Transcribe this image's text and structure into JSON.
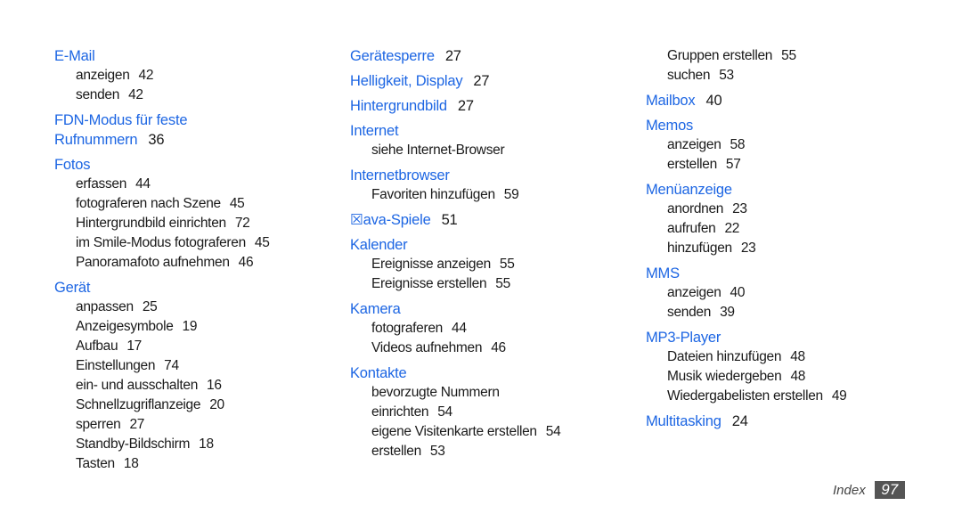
{
  "columns": [
    {
      "entries": [
        {
          "heading": "E-Mail",
          "page": "",
          "subs": [
            {
              "text": "anzeigen",
              "page": "42"
            },
            {
              "text": "senden",
              "page": "42"
            }
          ]
        },
        {
          "heading": "FDN-Modus für feste",
          "heading_cont": "Rufnummern",
          "page": "36",
          "subs": []
        },
        {
          "heading": "Fotos",
          "page": "",
          "subs": [
            {
              "text": "erfassen",
              "page": "44"
            },
            {
              "text": "fotograferen nach Szene",
              "page": "45"
            },
            {
              "text": "Hintergrundbild einrichten",
              "page": "72"
            },
            {
              "text": "im Smile-Modus fotograferen",
              "page": "45"
            },
            {
              "text": "Panoramafoto aufnehmen",
              "page": "46"
            }
          ]
        },
        {
          "heading": "Gerät",
          "page": "",
          "subs": [
            {
              "text": "anpassen",
              "page": "25"
            },
            {
              "text": "Anzeigesymbole",
              "page": "19"
            },
            {
              "text": "Aufbau",
              "page": "17"
            },
            {
              "text": "Einstellungen",
              "page": "74"
            },
            {
              "text": "ein- und ausschalten",
              "page": "16"
            },
            {
              "text": "Schnellzugriflanzeige",
              "page": "20"
            },
            {
              "text": "sperren",
              "page": "27"
            },
            {
              "text": "Standby-Bildschirm",
              "page": "18"
            },
            {
              "text": "Tasten",
              "page": "18"
            }
          ]
        }
      ]
    },
    {
      "entries": [
        {
          "heading": "Gerätesperre",
          "page": "27",
          "subs": []
        },
        {
          "heading": "Helligkeit, Display",
          "page": "27",
          "subs": []
        },
        {
          "heading": "Hintergrundbild",
          "page": "27",
          "subs": []
        },
        {
          "heading": "Internet",
          "page": "",
          "subs": [
            {
              "text": "siehe Internet-Browser",
              "page": ""
            }
          ]
        },
        {
          "heading": "Internetbrowser",
          "page": "",
          "subs": [
            {
              "text": "Favoriten hinzufügen",
              "page": "59"
            }
          ]
        },
        {
          "heading": "☒ava-Spiele",
          "page": "51",
          "subs": []
        },
        {
          "heading": "Kalender",
          "page": "",
          "subs": [
            {
              "text": "Ereignisse anzeigen",
              "page": "55"
            },
            {
              "text": "Ereignisse erstellen",
              "page": "55"
            }
          ]
        },
        {
          "heading": "Kamera",
          "page": "",
          "subs": [
            {
              "text": "fotograferen",
              "page": "44"
            },
            {
              "text": "Videos aufnehmen",
              "page": "46"
            }
          ]
        },
        {
          "heading": "Kontakte",
          "page": "",
          "subs": [
            {
              "text": "bevorzugte Nummern",
              "page": ""
            },
            {
              "text": "einrichten",
              "page": "54"
            },
            {
              "text": "eigene Visitenkarte erstellen",
              "page": "54"
            },
            {
              "text": "erstellen",
              "page": "53"
            }
          ]
        }
      ]
    },
    {
      "entries": [
        {
          "heading": "",
          "page": "",
          "subs": [
            {
              "text": "Gruppen erstellen",
              "page": "55"
            },
            {
              "text": "suchen",
              "page": "53"
            }
          ]
        },
        {
          "heading": "Mailbox",
          "page": "40",
          "subs": []
        },
        {
          "heading": "Memos",
          "page": "",
          "subs": [
            {
              "text": "anzeigen",
              "page": "58"
            },
            {
              "text": "erstellen",
              "page": "57"
            }
          ]
        },
        {
          "heading": "Menüanzeige",
          "page": "",
          "subs": [
            {
              "text": "anordnen",
              "page": "23"
            },
            {
              "text": "aufrufen",
              "page": "22"
            },
            {
              "text": "hinzufügen",
              "page": "23"
            }
          ]
        },
        {
          "heading": "MMS",
          "page": "",
          "subs": [
            {
              "text": "anzeigen",
              "page": "40"
            },
            {
              "text": "senden",
              "page": "39"
            }
          ]
        },
        {
          "heading": "MP3-Player",
          "page": "",
          "subs": [
            {
              "text": "Dateien hinzufügen",
              "page": "48"
            },
            {
              "text": "Musik wiedergeben",
              "page": "48"
            },
            {
              "text": "Wiedergabelisten erstellen",
              "page": "49"
            }
          ]
        },
        {
          "heading": "Multitasking",
          "page": "24",
          "subs": []
        }
      ]
    }
  ],
  "footer": {
    "label": "Index",
    "page_number": "97"
  },
  "colors": {
    "heading": "#1d66e3",
    "text": "#1a1a1a",
    "page_badge": "#555555"
  }
}
